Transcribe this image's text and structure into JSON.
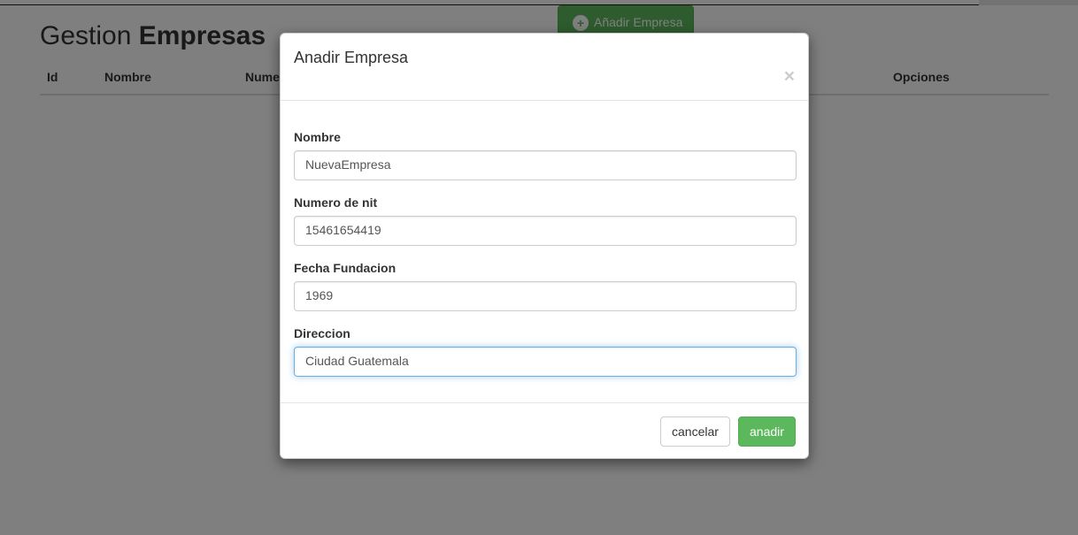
{
  "page": {
    "title_normal": "Gestion ",
    "title_bold": "Empresas",
    "add_button_label": "Añadir Empresa",
    "table_headers": [
      "Id",
      "Nombre",
      "Nume",
      "Opciones"
    ]
  },
  "modal": {
    "title": "Anadir Empresa",
    "close_symbol": "×",
    "fields": [
      {
        "label": "Nombre",
        "value": "NuevaEmpresa"
      },
      {
        "label": "Numero de nit",
        "value": "15461654419"
      },
      {
        "label": "Fecha Fundacion",
        "value": "1969"
      },
      {
        "label": "Direccion",
        "value": "Ciudad Guatemala"
      }
    ],
    "cancel_label": "cancelar",
    "submit_label": "anadir"
  },
  "colors": {
    "success": "#5cb85c",
    "focus_border": "#66afe9",
    "backdrop": "rgba(0,0,0,0.5)"
  }
}
